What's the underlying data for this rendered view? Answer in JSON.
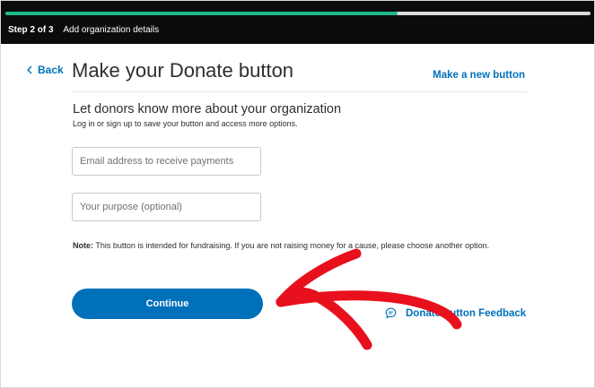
{
  "stepbar": {
    "step_count": "Step 2 of 3",
    "step_text": "Add organization details",
    "progress_fraction": 0.67,
    "progress_color": "#1bb98a"
  },
  "header": {
    "back_label": "Back",
    "back_icon": "chevron-left-icon",
    "title": "Make your Donate button",
    "new_button_label": "Make a new button"
  },
  "form": {
    "heading": "Let donors know more about your organization",
    "subheading": "Log in or sign up to save your button and access more options.",
    "email_placeholder": "Email address to receive payments",
    "purpose_placeholder": "Your purpose (optional)",
    "note_label": "Note:",
    "note_text": " This button is intended for fundraising. If you are not raising money for a cause, please choose another option.",
    "continue_label": "Continue"
  },
  "feedback": {
    "label": "Donate button Feedback",
    "icon": "chat-bubble-icon"
  },
  "colors": {
    "brand_blue": "#0070ba",
    "annotation_red": "#e8101d"
  }
}
